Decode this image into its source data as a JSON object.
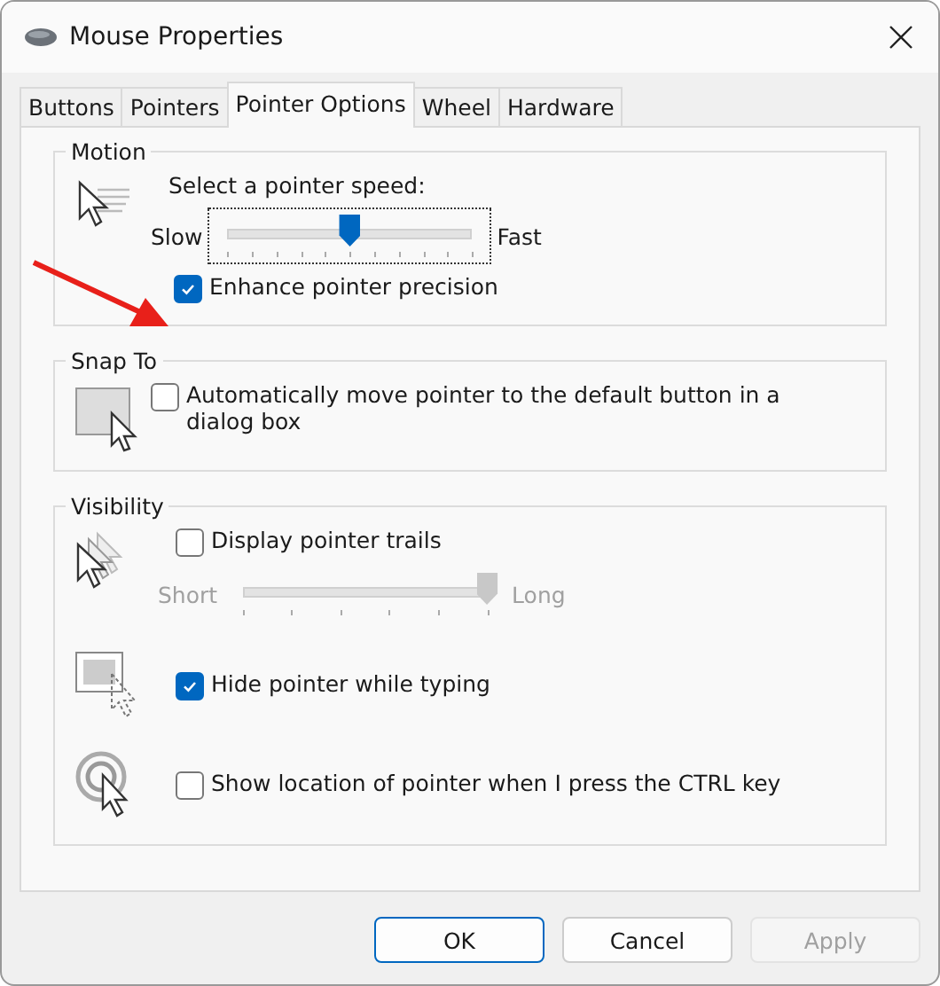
{
  "window": {
    "title": "Mouse Properties"
  },
  "tabs": [
    {
      "label": "Buttons",
      "selected": false
    },
    {
      "label": "Pointers",
      "selected": false
    },
    {
      "label": "Pointer Options",
      "selected": true
    },
    {
      "label": "Wheel",
      "selected": false
    },
    {
      "label": "Hardware",
      "selected": false
    }
  ],
  "motion": {
    "title": "Motion",
    "speed_label": "Select a pointer speed:",
    "slow": "Slow",
    "fast": "Fast",
    "speed": {
      "level": 0.5
    },
    "enhance": {
      "label": "Enhance pointer precision",
      "checked": true
    }
  },
  "snap_to": {
    "title": "Snap To",
    "option": {
      "label": "Automatically move pointer to the default button in a dialog box",
      "checked": false
    }
  },
  "visibility": {
    "title": "Visibility",
    "trails": {
      "label": "Display pointer trails",
      "checked": false
    },
    "short": "Short",
    "long": "Long",
    "trail_length": {
      "level": 1.0,
      "disabled": true
    },
    "hide": {
      "label": "Hide pointer while typing",
      "checked": true
    },
    "show_location": {
      "label": "Show location of pointer when I press the CTRL key",
      "checked": false
    }
  },
  "buttons": [
    {
      "label": "OK",
      "kind": "default",
      "disabled": false
    },
    {
      "label": "Cancel",
      "kind": "normal",
      "disabled": false
    },
    {
      "label": "Apply",
      "kind": "normal",
      "disabled": true
    }
  ]
}
